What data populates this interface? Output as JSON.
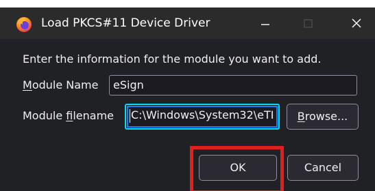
{
  "window": {
    "title": "Load PKCS#11 Device Driver",
    "icon": "firefox-icon",
    "controls": {
      "minimize": "minimize-icon",
      "maximize": "maximize-icon",
      "close": "close-icon"
    }
  },
  "dialog": {
    "intro": "Enter the information for the module you want to add.",
    "module_name": {
      "label_accesskey": "M",
      "label_rest": "odule Name",
      "value": "eSign"
    },
    "module_filename": {
      "label_before": "Module ",
      "label_accesskey": "f",
      "label_rest": "ilename",
      "value": "C:\\Windows\\System32\\eTI"
    },
    "buttons": {
      "browse_accesskey": "B",
      "browse_rest": "rowse...",
      "ok": "OK",
      "cancel": "Cancel"
    }
  },
  "annotation": {
    "highlight_color": "#e01f1f"
  }
}
